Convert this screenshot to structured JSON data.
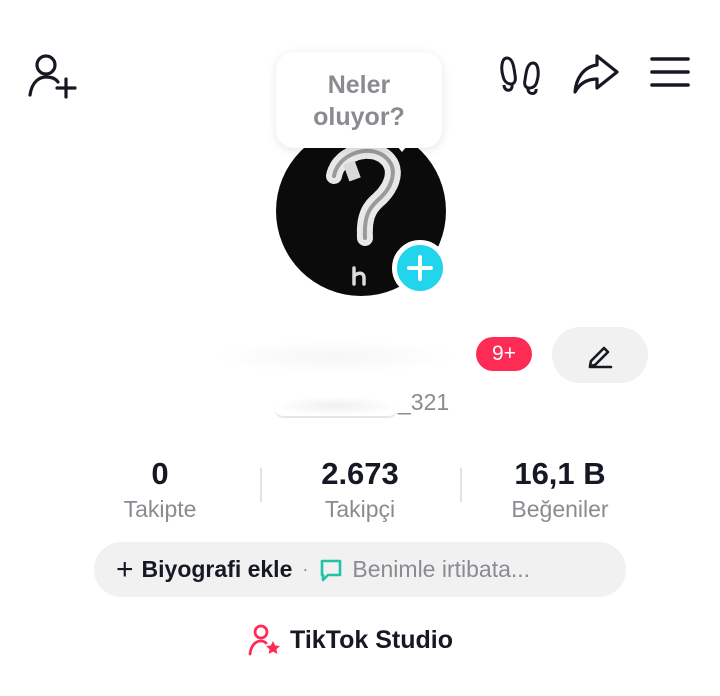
{
  "header": {
    "add_friend_icon": "person-plus-icon",
    "footprint_icon": "footprint-icon",
    "share_icon": "share-arrow-icon",
    "menu_icon": "hamburger-menu-icon"
  },
  "bubble": {
    "line1": "Neler",
    "line2": "oluyor?"
  },
  "profile": {
    "notification_badge": "9+",
    "username_suffix": "_321",
    "edit_icon": "pencil-icon"
  },
  "stats": [
    {
      "value": "0",
      "label": "Takipte"
    },
    {
      "value": "2.673",
      "label": "Takipçi"
    },
    {
      "value": "16,1 B",
      "label": "Beğeniler"
    }
  ],
  "bio": {
    "add_plus": "+",
    "add_label": "Biyografi ekle",
    "separator": "·",
    "contact_label": "Benimle irtibata..."
  },
  "studio": {
    "label": "TikTok Studio"
  },
  "colors": {
    "accent": "#fe2c55",
    "cyan": "#20d5ec",
    "teal": "#20c4a5",
    "gray_text": "#8a8b91",
    "pill_bg": "#f1f1f2"
  }
}
